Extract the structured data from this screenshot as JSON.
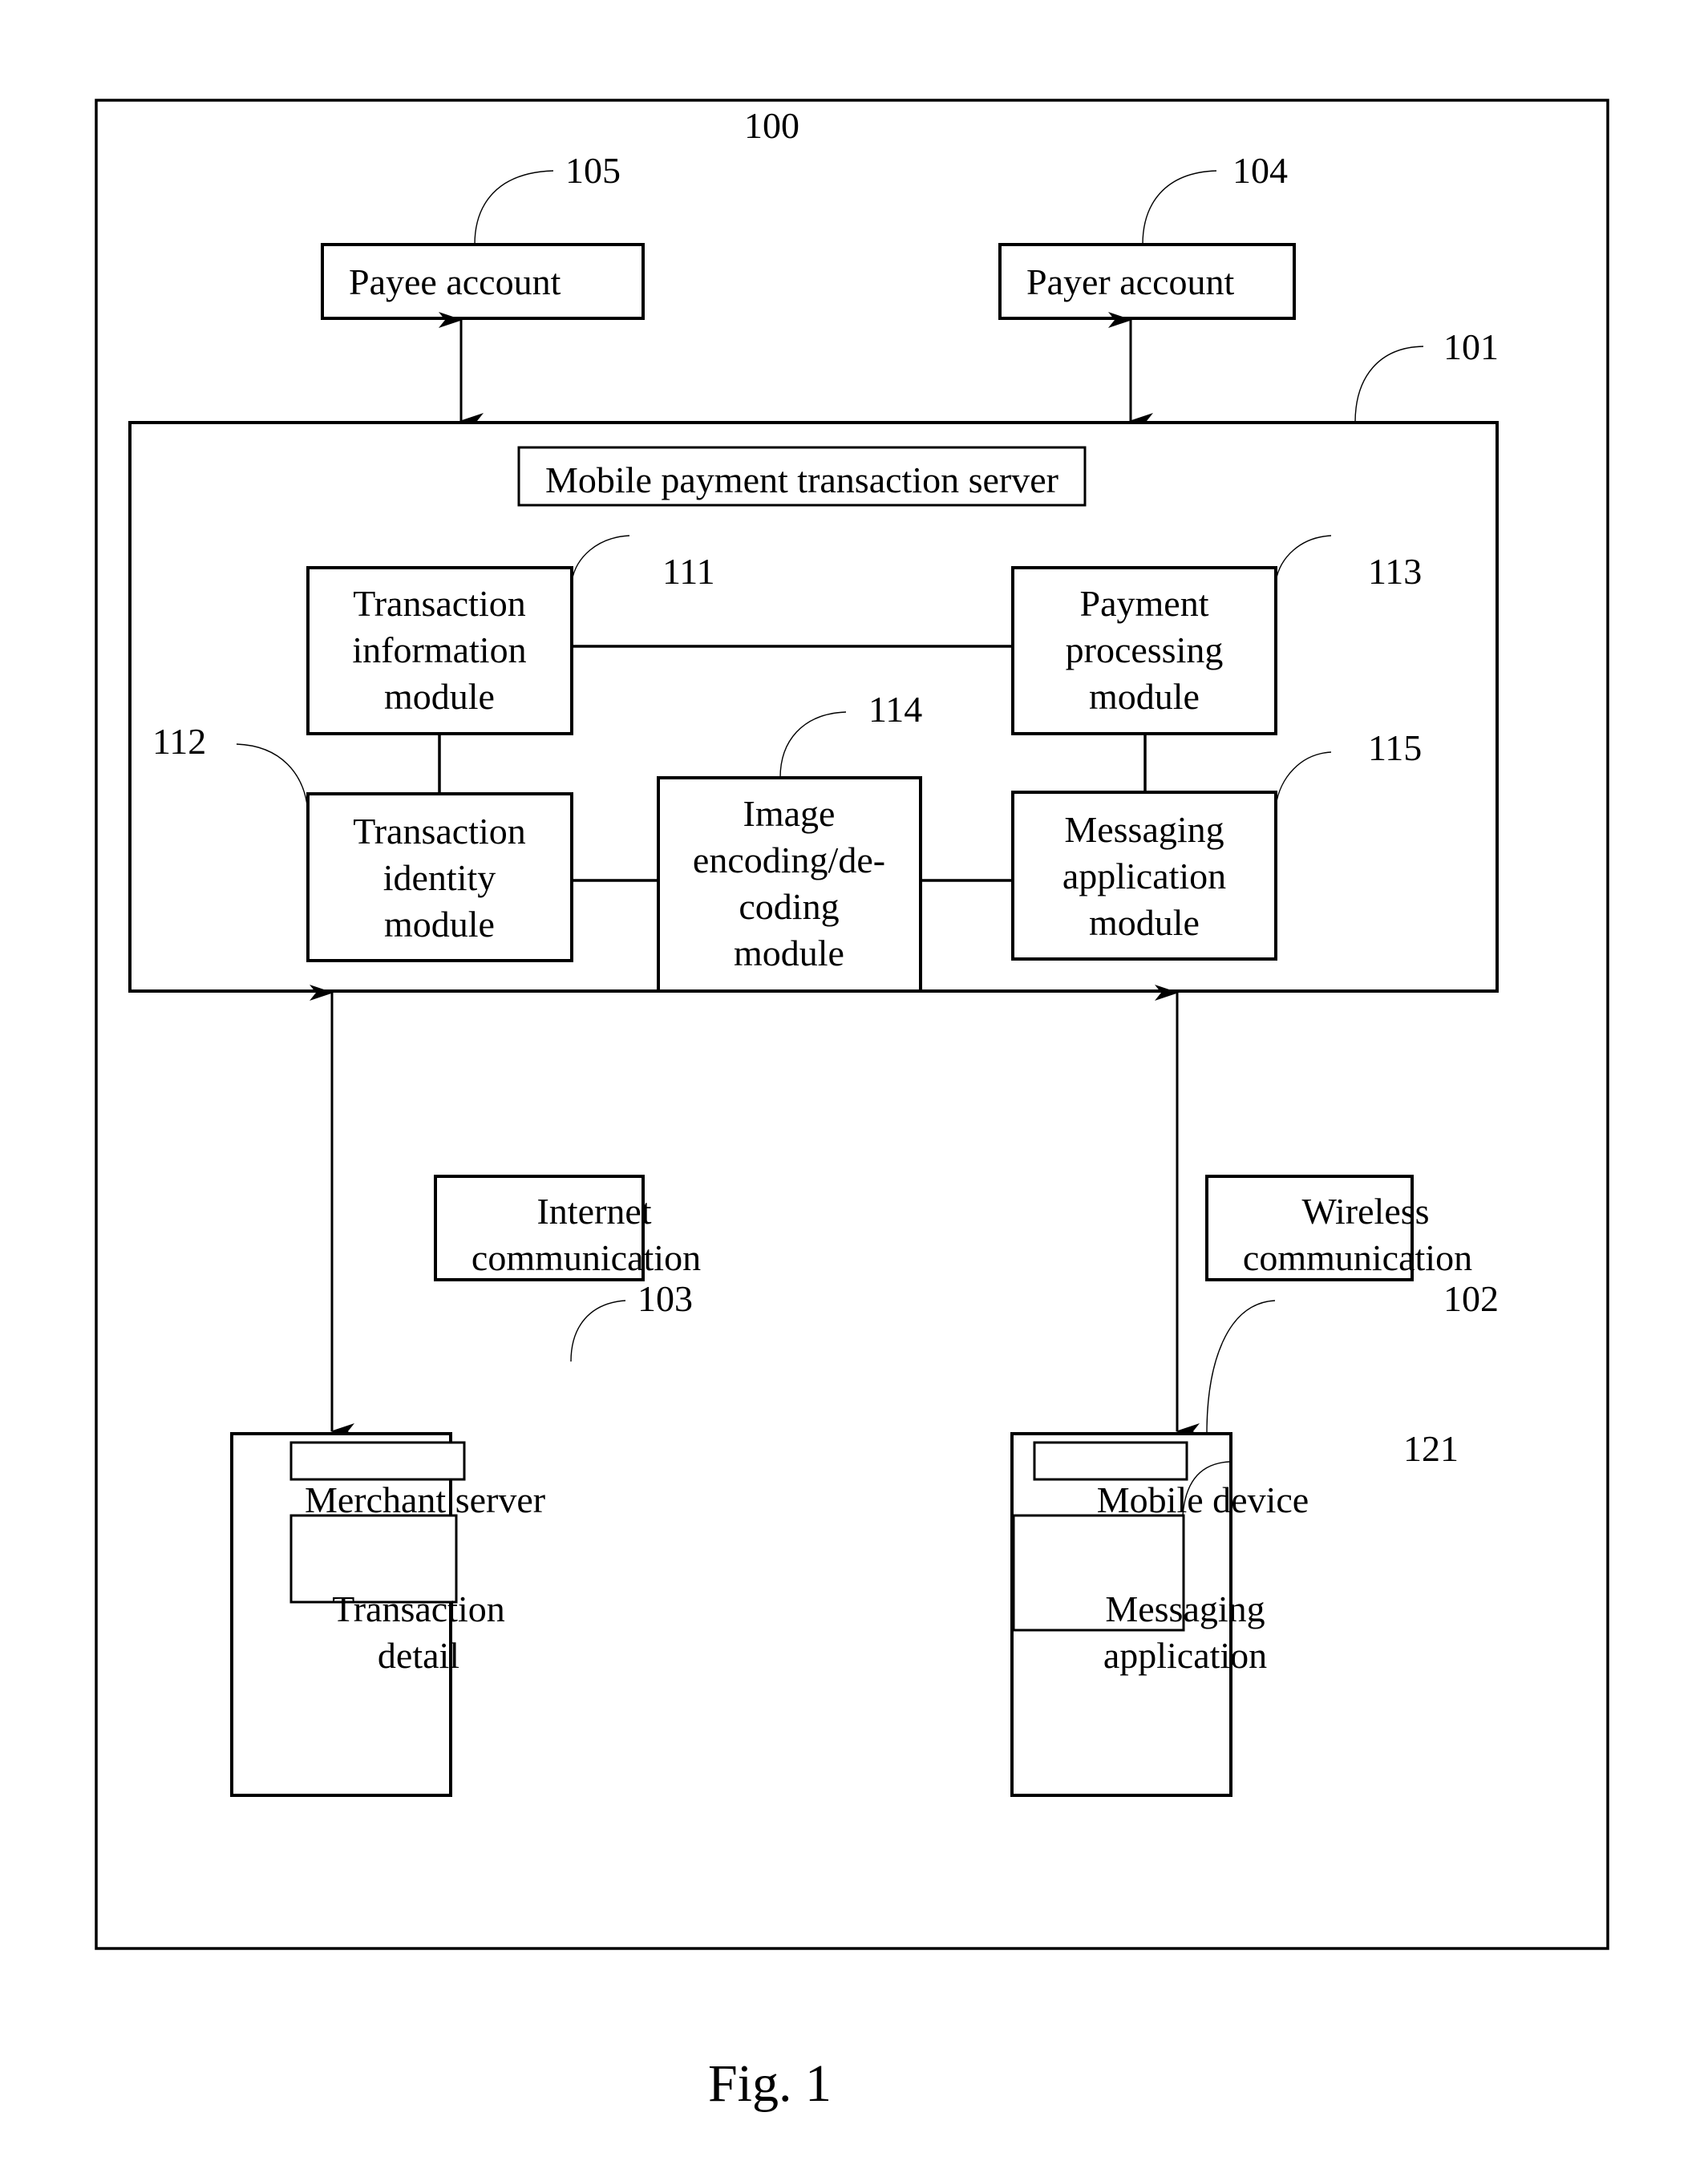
{
  "figure": {
    "caption": "Fig. 1",
    "system_ref": "100"
  },
  "nodes": {
    "payee_account": {
      "ref": "105",
      "lines": [
        "Payee account"
      ]
    },
    "payer_account": {
      "ref": "104",
      "lines": [
        "Payer account"
      ]
    },
    "server": {
      "ref": "101",
      "title": "Mobile payment transaction server"
    },
    "transaction_information_module": {
      "ref": "111",
      "lines": [
        "Transaction",
        "information",
        "module"
      ]
    },
    "payment_processing_module": {
      "ref": "113",
      "lines": [
        "Payment",
        "processing",
        "module"
      ]
    },
    "transaction_identity_module": {
      "ref": "112",
      "lines": [
        "Transaction",
        "identity",
        "module"
      ]
    },
    "image_codec_module": {
      "ref": "114",
      "lines": [
        "Image",
        "encoding/de-",
        "coding",
        "module"
      ]
    },
    "messaging_application_module": {
      "ref": "115",
      "lines": [
        "Messaging",
        "application",
        "module"
      ]
    },
    "internet_communication": {
      "lines": [
        "Internet",
        "communication"
      ]
    },
    "wireless_communication": {
      "lines": [
        "Wireless",
        "communication"
      ]
    },
    "merchant_server": {
      "ref": "103",
      "title": "Merchant server"
    },
    "transaction_detail": {
      "lines": [
        "Transaction",
        "detail"
      ]
    },
    "mobile_device": {
      "ref": "102",
      "title": "Mobile device"
    },
    "messaging_application": {
      "ref": "121",
      "lines": [
        "Messaging",
        "application"
      ]
    }
  },
  "connections": [
    {
      "from": "payee_account",
      "to": "server",
      "type": "bidirectional-arrow"
    },
    {
      "from": "payer_account",
      "to": "server",
      "type": "bidirectional-arrow"
    },
    {
      "from": "transaction_information_module",
      "to": "payment_processing_module",
      "type": "line"
    },
    {
      "from": "transaction_information_module",
      "to": "transaction_identity_module",
      "type": "line"
    },
    {
      "from": "payment_processing_module",
      "to": "messaging_application_module",
      "type": "line"
    },
    {
      "from": "transaction_identity_module",
      "to": "image_codec_module",
      "type": "line"
    },
    {
      "from": "image_codec_module",
      "to": "messaging_application_module",
      "type": "line"
    },
    {
      "from": "server",
      "to": "merchant_server",
      "type": "bidirectional-arrow",
      "label": "Internet communication"
    },
    {
      "from": "server",
      "to": "mobile_device",
      "type": "bidirectional-arrow",
      "label": "Wireless communication"
    }
  ]
}
